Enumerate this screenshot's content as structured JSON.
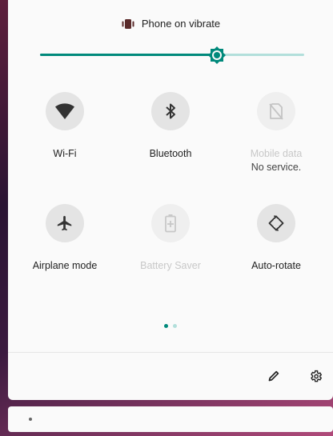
{
  "status": {
    "text": "Phone on vibrate",
    "icon": "vibrate-icon"
  },
  "brightness": {
    "level": 0.67,
    "accent": "#00897b",
    "track": "#b2dfdb",
    "icon": "brightness-icon"
  },
  "tiles": [
    {
      "label": "Wi-Fi",
      "sublabel": "",
      "icon": "wifi-icon",
      "enabled": true
    },
    {
      "label": "Bluetooth",
      "sublabel": "",
      "icon": "bluetooth-icon",
      "enabled": true
    },
    {
      "label": "Mobile data",
      "sublabel": "No service.",
      "icon": "mobile-data-icon",
      "enabled": false
    },
    {
      "label": "Airplane mode",
      "sublabel": "",
      "icon": "airplane-icon",
      "enabled": true
    },
    {
      "label": "Battery Saver",
      "sublabel": "",
      "icon": "battery-saver-icon",
      "enabled": false
    },
    {
      "label": "Auto-rotate",
      "sublabel": "",
      "icon": "auto-rotate-icon",
      "enabled": true
    }
  ],
  "pagination": {
    "pages": 2,
    "current": 1
  },
  "actions": {
    "edit_icon": "edit-icon",
    "settings_icon": "settings-icon"
  }
}
